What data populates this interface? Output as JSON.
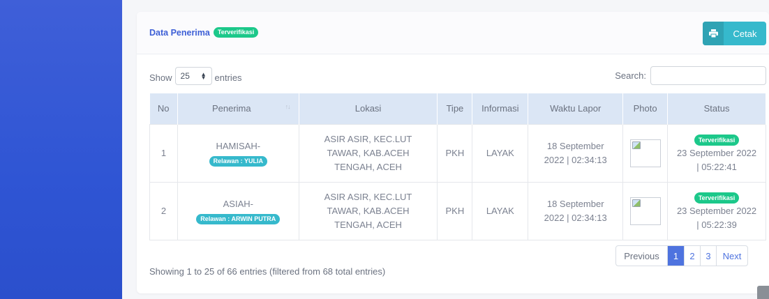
{
  "card": {
    "title": "Data Penerima",
    "title_badge": "Terverifikasi",
    "print_label": "Cetak"
  },
  "controls": {
    "show_label": "Show",
    "entries_value": "25",
    "entries_label": "entries",
    "search_label": "Search:"
  },
  "table": {
    "headers": [
      "No",
      "Penerima",
      "Lokasi",
      "Tipe",
      "Informasi",
      "Waktu Lapor",
      "Photo",
      "Status"
    ],
    "rows": [
      {
        "no": "1",
        "name": "HAMISAH-",
        "volunteer": "Relawan : YULIA",
        "location": "ASIR ASIR, KEC.LUT TAWAR, KAB.ACEH TENGAH, ACEH",
        "type": "PKH",
        "info": "LAYAK",
        "report_time": "18 September 2022 | 02:34:13",
        "status_badge": "Terverifikasi",
        "status_time": "23 September 2022 | 05:22:41"
      },
      {
        "no": "2",
        "name": "ASIAH-",
        "volunteer": "Relawan : ARWIN PUTRA",
        "location": "ASIR ASIR, KEC.LUT TAWAR, KAB.ACEH TENGAH, ACEH",
        "type": "PKH",
        "info": "LAYAK",
        "report_time": "18 September 2022 | 02:34:13",
        "status_badge": "Terverifikasi",
        "status_time": "23 September 2022 | 05:22:39"
      }
    ]
  },
  "footer": {
    "info": "Showing 1 to 25 of 66 entries (filtered from 68 total entries)",
    "pagination": {
      "prev": "Previous",
      "pages": [
        "1",
        "2",
        "3"
      ],
      "next": "Next",
      "active": "1"
    }
  },
  "colors": {
    "sidebar": "#2f55d4",
    "primary": "#4e73df",
    "success": "#1cc88a",
    "info": "#36b9cc"
  },
  "icons": {
    "print": "printer-icon",
    "sort": "sort-icon",
    "select_arrow": "updown-chevron-icon"
  }
}
